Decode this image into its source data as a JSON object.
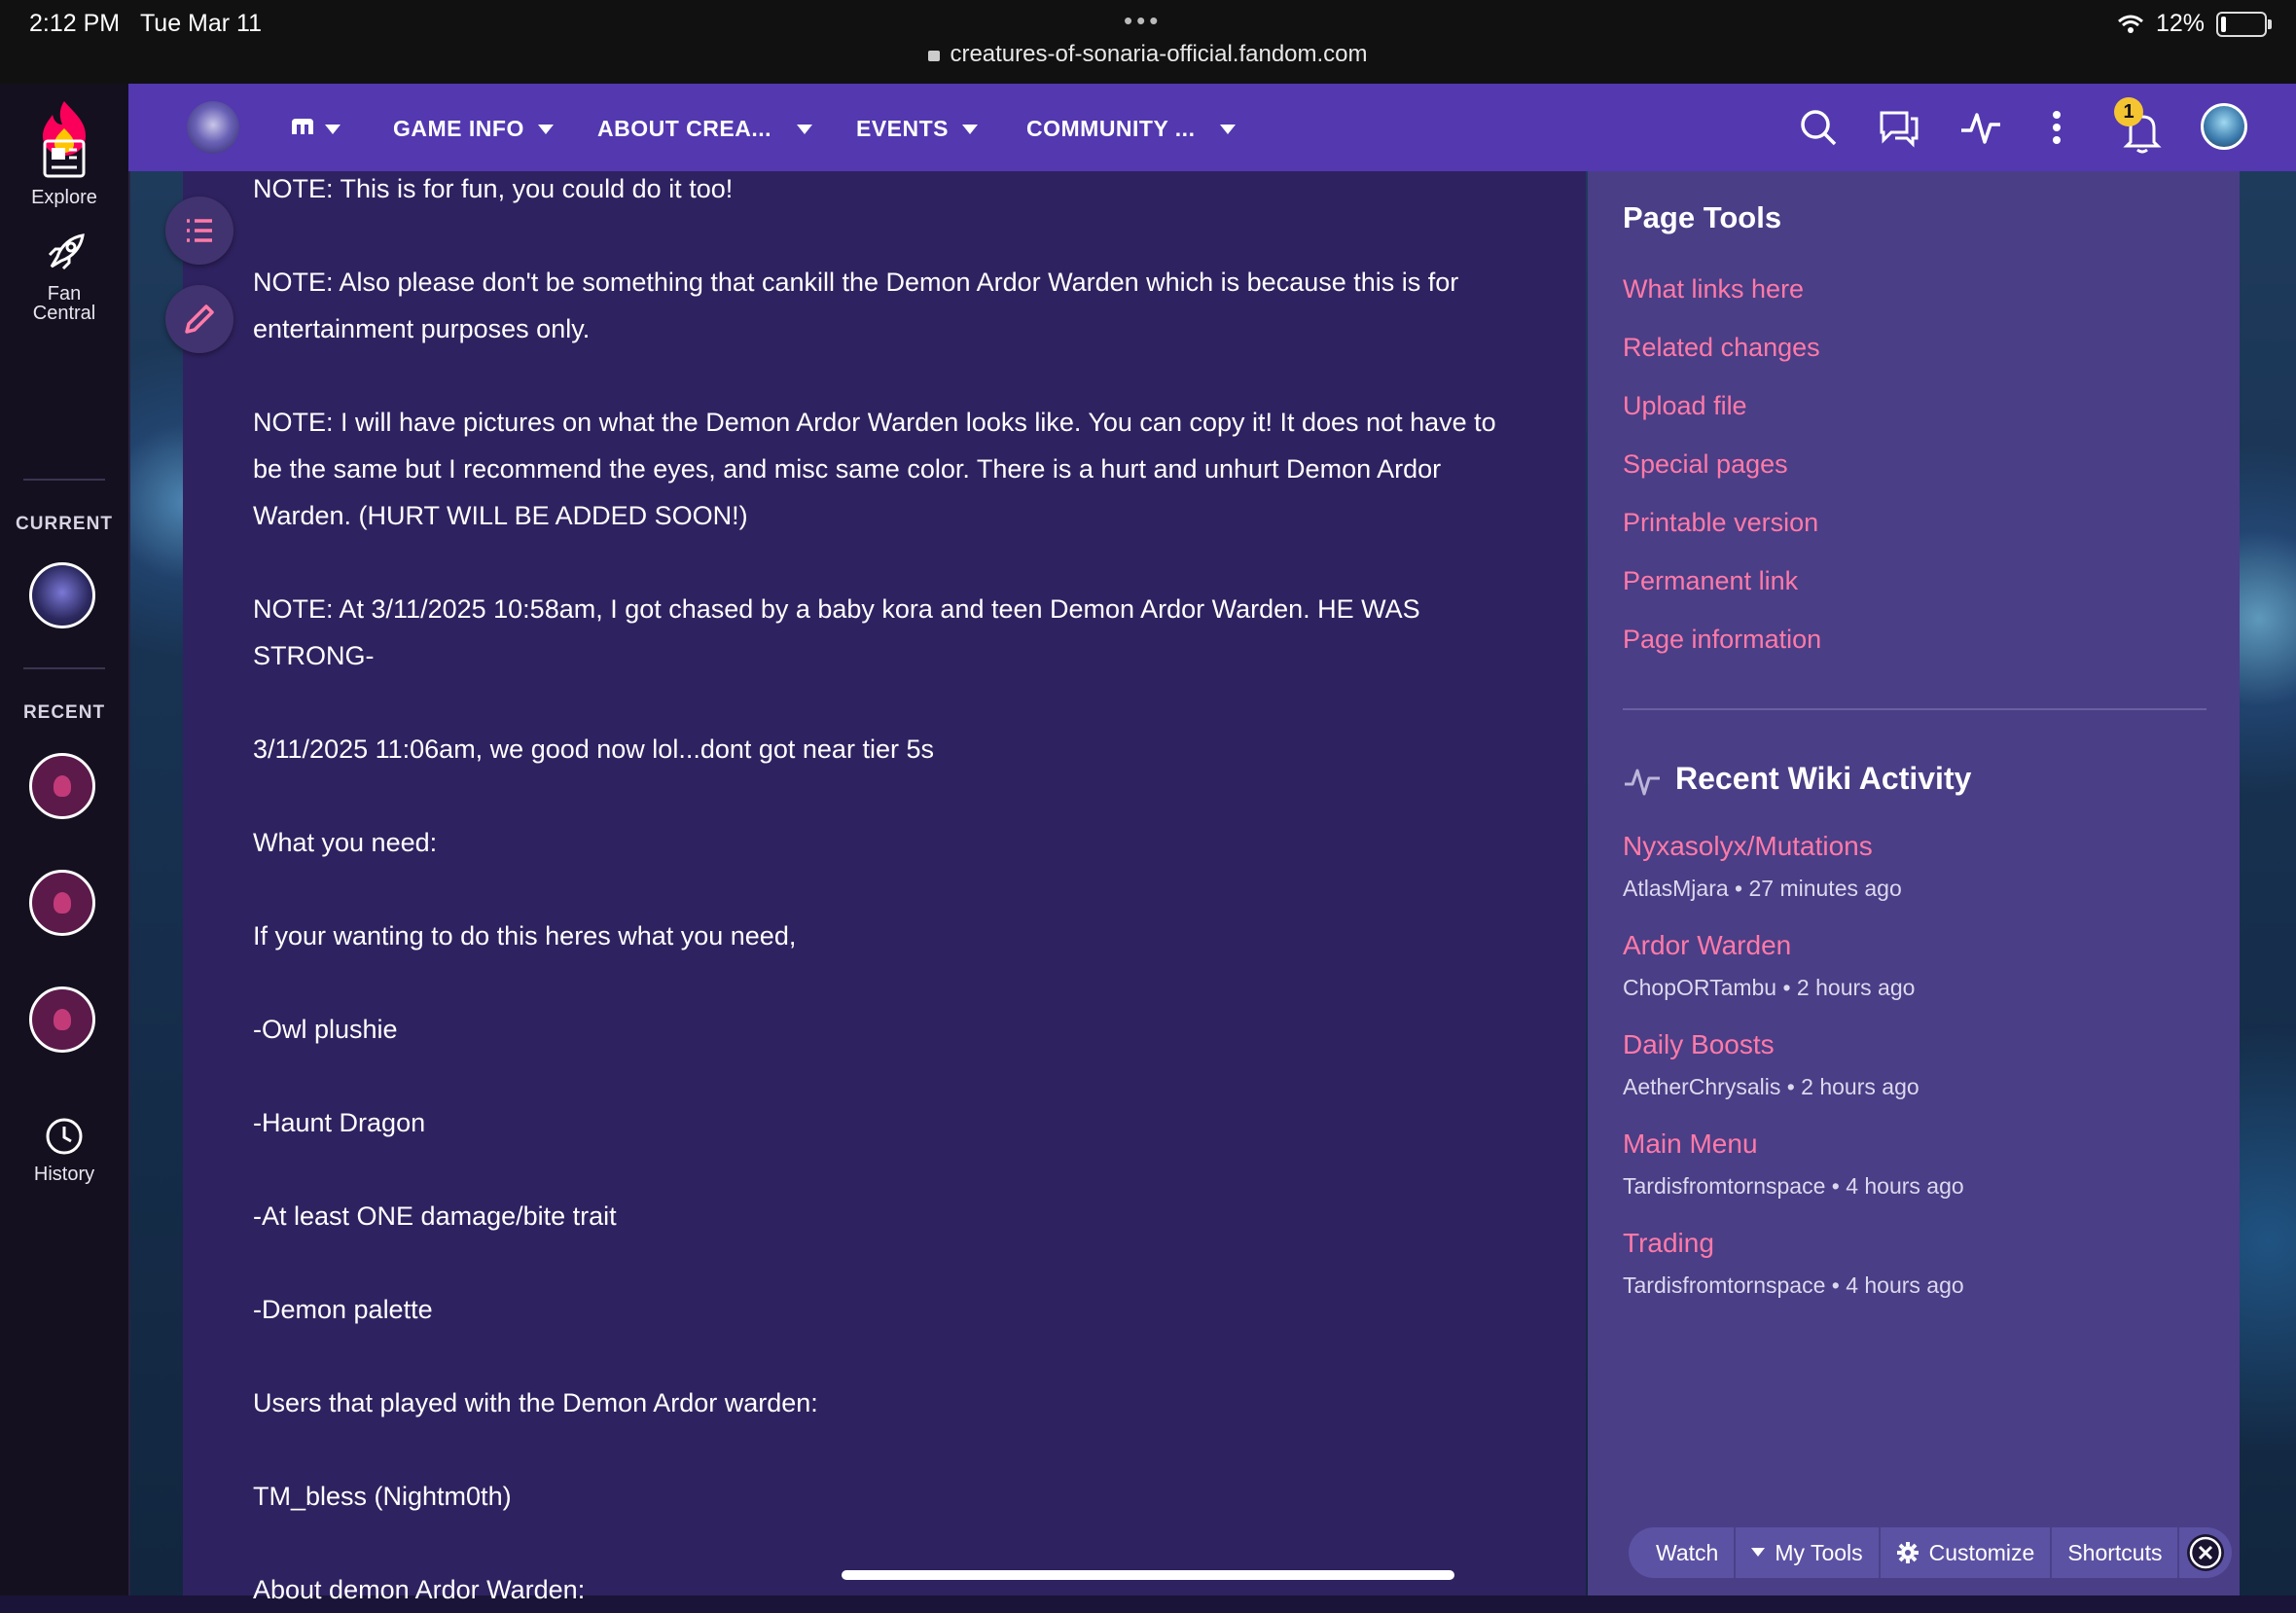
{
  "status_bar": {
    "time": "2:12 PM",
    "date": "Tue Mar 11",
    "url": "creatures-of-sonaria-official.fandom.com",
    "battery": "12%"
  },
  "rail": {
    "explore": "Explore",
    "fan_central_line1": "Fan",
    "fan_central_line2": "Central",
    "current_label": "CURRENT",
    "recent_label": "RECENT",
    "history": "History"
  },
  "nav": {
    "items": [
      "GAME INFO",
      "ABOUT CREA...",
      "EVENTS",
      "COMMUNITY ..."
    ],
    "notification_count": "1"
  },
  "article": {
    "paragraphs": [
      "NOTE: This is for fun, you could do it too!",
      "NOTE: Also please don't be something that cankill the Demon Ardor Warden which is because this is for entertainment purposes only.",
      "NOTE: I will have pictures on what the Demon Ardor Warden looks like. You can copy it! It does not have to be the same but I recommend the eyes, and misc same color. There is a hurt and unhurt Demon Ardor Warden. (HURT WILL BE ADDED SOON!)",
      "NOTE: At 3/11/2025 10:58am, I got chased by a baby kora and teen Demon Ardor Warden. HE WAS STRONG-",
      "3/11/2025 11:06am, we good now lol...dont got near tier 5s",
      "What you need:",
      "If your wanting to do this heres what you need,",
      "-Owl plushie",
      "-Haunt Dragon",
      "-At least ONE damage/bite trait",
      "-Demon palette",
      "Users that played with the Demon Ardor warden:",
      "TM_bless (Nightm0th)",
      "About demon Ardor Warden:"
    ]
  },
  "page_tools": {
    "title": "Page Tools",
    "links": [
      "What links here",
      "Related changes",
      "Upload file",
      "Special pages",
      "Printable version",
      "Permanent link",
      "Page information"
    ]
  },
  "recent_activity": {
    "title": "Recent Wiki Activity",
    "items": [
      {
        "title": "Nyxasolyx/Mutations",
        "meta": "AtlasMjara • 27 minutes ago"
      },
      {
        "title": "Ardor Warden",
        "meta": "ChopORTambu • 2 hours ago"
      },
      {
        "title": "Daily Boosts",
        "meta": "AetherChrysalis • 2 hours ago"
      },
      {
        "title": "Main Menu",
        "meta": "Tardisfromtornspace • 4 hours ago"
      },
      {
        "title": "Trading",
        "meta": "Tardisfromtornspace • 4 hours ago"
      }
    ]
  },
  "toolbar": {
    "watch": "Watch",
    "my_tools": "My Tools",
    "customize": "Customize",
    "shortcuts": "Shortcuts"
  },
  "colors": {
    "nav": "#5338b0",
    "article_bg": "#2f2260",
    "panel_bg": "#4a3e86",
    "link": "#ff7aa8",
    "rail_bg": "#15101f"
  }
}
